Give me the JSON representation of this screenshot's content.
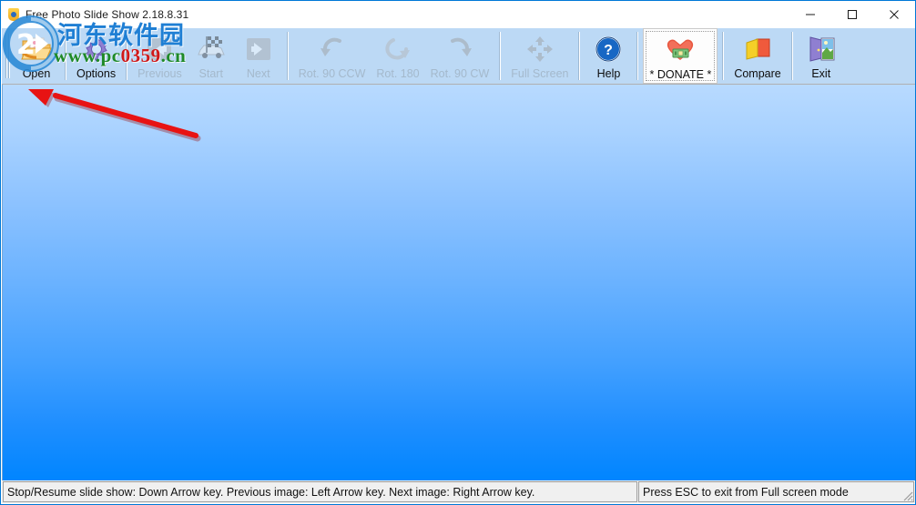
{
  "window": {
    "title": "Free Photo Slide Show 2.18.8.31",
    "icon": "app-shield-icon",
    "controls": {
      "minimize": "minimize-icon",
      "maximize": "maximize-icon",
      "close": "close-icon"
    }
  },
  "toolbar": {
    "buttons": [
      {
        "label": "Open",
        "icon": "open-folder-icon",
        "state": "enabled"
      },
      {
        "label": "Options",
        "icon": "gear-icon",
        "state": "enabled"
      },
      {
        "label": "Previous",
        "icon": "arrow-left-icon",
        "state": "disabled"
      },
      {
        "label": "Start",
        "icon": "race-car-flag-icon",
        "state": "disabled"
      },
      {
        "label": "Next",
        "icon": "arrow-right-icon",
        "state": "disabled"
      },
      {
        "label": "Rot. 90 CCW",
        "icon": "rotate-ccw-icon",
        "state": "disabled"
      },
      {
        "label": "Rot. 180",
        "icon": "rotate-180-icon",
        "state": "disabled"
      },
      {
        "label": "Rot. 90 CW",
        "icon": "rotate-cw-icon",
        "state": "disabled"
      },
      {
        "label": "Full Screen",
        "icon": "fullscreen-arrows-icon",
        "state": "disabled"
      },
      {
        "label": "Help",
        "icon": "question-mark-icon",
        "state": "enabled"
      },
      {
        "label": "* DONATE *",
        "icon": "heart-money-icon",
        "state": "hot"
      },
      {
        "label": "Compare",
        "icon": "compare-cards-icon",
        "state": "enabled"
      },
      {
        "label": "Exit",
        "icon": "exit-door-icon",
        "state": "enabled"
      }
    ]
  },
  "statusbar": {
    "left": "Stop/Resume slide show: Down Arrow key. Previous image: Left Arrow key. Next image: Right Arrow key.",
    "right": "Press ESC to exit from Full screen mode",
    "grip": "resize-grip-icon"
  },
  "watermark": {
    "logo": "site-logo-icon",
    "chinese": "河东软件园",
    "url_green_1": "www.pc",
    "url_red": "0359",
    "url_green_2": ".cn"
  },
  "annotation": {
    "arrow": "red-pointer-arrow",
    "color": "#e81313"
  },
  "colors": {
    "titlebar_border": "#0078d7",
    "toolbar_bg": "#bcd9f5",
    "canvas_top": "#b8daff",
    "canvas_bottom": "#0085ff",
    "statusbar_bg": "#f0f0f0"
  }
}
